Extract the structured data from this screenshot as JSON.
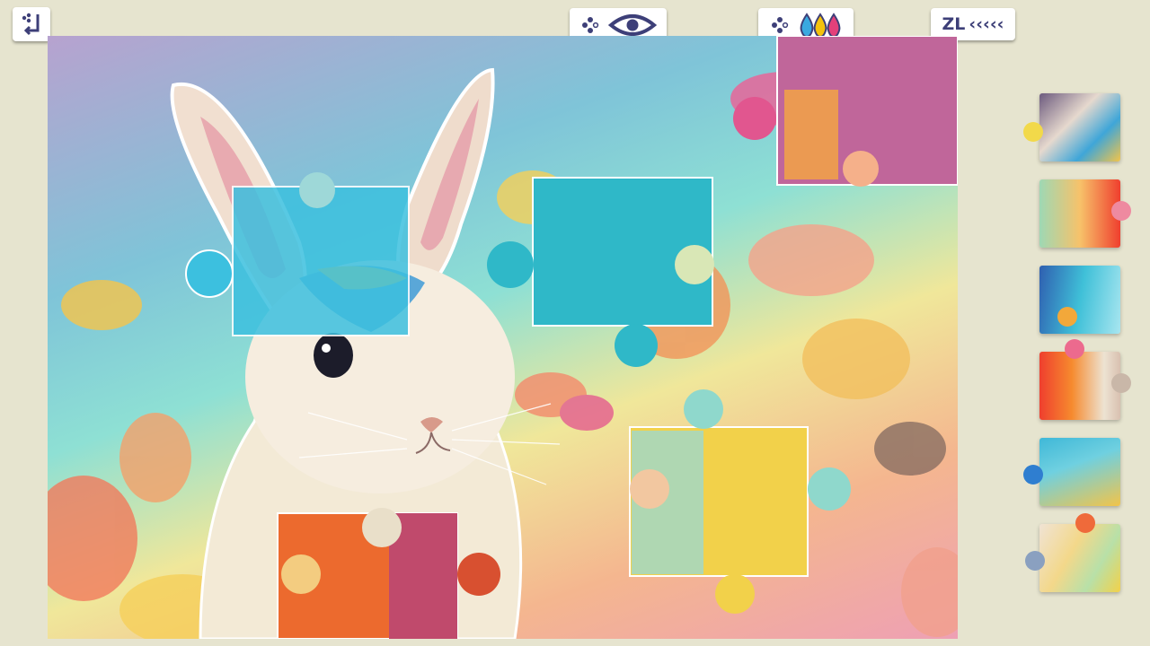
{
  "toolbar": {
    "exit_icon": "exit-arrow-icon",
    "preview_icon": "eye-icon",
    "color_icon": "paint-drops-icon",
    "controller_hint": "gamepad-dots-icon",
    "zoom_label": "ZL",
    "zoom_chevrons": "‹‹‹‹‹"
  },
  "board": {
    "image_subject": "rabbit-painting"
  },
  "tray": {
    "piece_count": 6
  },
  "colors": {
    "background": "#e6e4cf",
    "accent": "#3d3f78",
    "drop_blue": "#3aa9e0",
    "drop_yellow": "#f4c20d",
    "drop_pink": "#e4407a"
  }
}
